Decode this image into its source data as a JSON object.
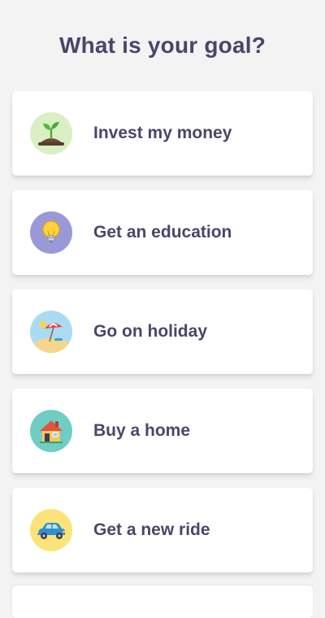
{
  "header": {
    "title": "What is your goal?"
  },
  "goals": [
    {
      "label": "Invest my money",
      "icon": "sprout-icon",
      "icon_bg": "#d9f0c4"
    },
    {
      "label": "Get an education",
      "icon": "lightbulb-icon",
      "icon_bg": "#9a99d8"
    },
    {
      "label": "Go on holiday",
      "icon": "beach-umbrella-icon",
      "icon_bg": "#a9dcf3"
    },
    {
      "label": "Buy a home",
      "icon": "house-icon",
      "icon_bg": "#6fcdc4"
    },
    {
      "label": "Get a new ride",
      "icon": "car-icon",
      "icon_bg": "#fbe37a"
    }
  ],
  "colors": {
    "background": "#f3f3f4",
    "text": "#4a4668",
    "card": "#ffffff"
  }
}
